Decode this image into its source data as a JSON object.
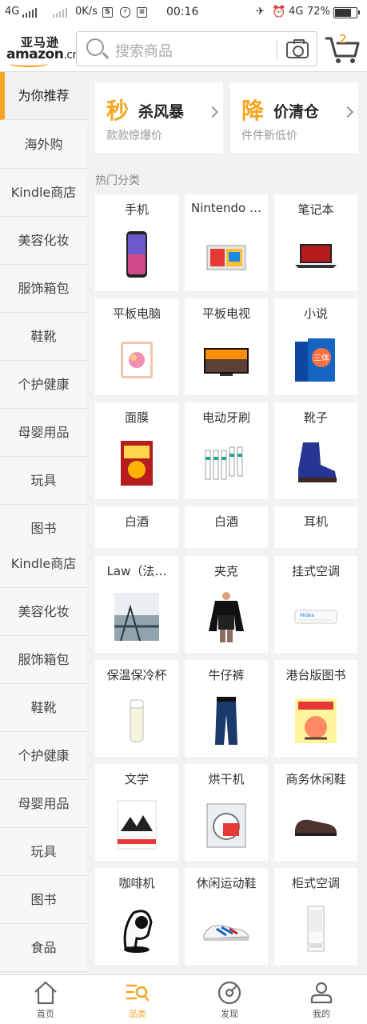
{
  "status_bar": {
    "network": "4G",
    "speed": "0K/s",
    "time": "00:16",
    "network_right": "4G",
    "battery": "72%"
  },
  "header": {
    "logo_cn": "亚马逊",
    "logo_en": "amazon",
    "logo_domain": ".cn",
    "search_placeholder": "搜索商品",
    "cart_count": "2"
  },
  "sidebar": {
    "items": [
      {
        "label": "为你推荐",
        "active": true
      },
      {
        "label": "海外购"
      },
      {
        "label": "Kindle商店"
      },
      {
        "label": "美容化妆"
      },
      {
        "label": "服饰箱包"
      },
      {
        "label": "鞋靴"
      },
      {
        "label": "个护健康"
      },
      {
        "label": "母婴用品"
      },
      {
        "label": "玩具"
      },
      {
        "label": "图书"
      },
      {
        "label": "Kindle商店"
      },
      {
        "label": "美容化妆"
      },
      {
        "label": "服饰箱包"
      },
      {
        "label": "鞋靴"
      },
      {
        "label": "个护健康"
      },
      {
        "label": "母婴用品"
      },
      {
        "label": "玩具"
      },
      {
        "label": "图书"
      },
      {
        "label": "食品"
      }
    ]
  },
  "promos": [
    {
      "icon_char": "秒",
      "title": "杀风暴",
      "subtitle": "款款惊爆价"
    },
    {
      "icon_char": "降",
      "title": "价清仓",
      "subtitle": "件件新低价"
    }
  ],
  "section_title": "热门分类",
  "categories": [
    {
      "label": "手机",
      "icon": "phone"
    },
    {
      "label": "Nintendo …",
      "icon": "game-console"
    },
    {
      "label": "笔记本",
      "icon": "laptop"
    },
    {
      "label": "平板电脑",
      "icon": "tablet"
    },
    {
      "label": "平板电视",
      "icon": "tv"
    },
    {
      "label": "小说",
      "icon": "books"
    },
    {
      "label": "面膜",
      "icon": "face-mask"
    },
    {
      "label": "电动牙刷",
      "icon": "toothbrush-heads"
    },
    {
      "label": "靴子",
      "icon": "boot"
    },
    {
      "label": "白酒",
      "icon": "none"
    },
    {
      "label": "白酒",
      "icon": "none"
    },
    {
      "label": "耳机",
      "icon": "none"
    },
    {
      "label": "Law（法…",
      "icon": "law-book"
    },
    {
      "label": "夹克",
      "icon": "jacket"
    },
    {
      "label": "挂式空调",
      "icon": "air-conditioner"
    },
    {
      "label": "保温保冷杯",
      "icon": "thermos"
    },
    {
      "label": "牛仔裤",
      "icon": "jeans"
    },
    {
      "label": "港台版图书",
      "icon": "hk-book"
    },
    {
      "label": "文学",
      "icon": "literature-book"
    },
    {
      "label": "烘干机",
      "icon": "dryer"
    },
    {
      "label": "商务休闲鞋",
      "icon": "leather-shoe"
    },
    {
      "label": "咖啡机",
      "icon": "coffee-machine"
    },
    {
      "label": "休闲运动鞋",
      "icon": "sneaker"
    },
    {
      "label": "柜式空调",
      "icon": "tower-ac"
    }
  ],
  "tabbar": {
    "items": [
      {
        "label": "首页",
        "icon": "home-icon"
      },
      {
        "label": "品类",
        "icon": "category-icon",
        "active": true
      },
      {
        "label": "发现",
        "icon": "discover-icon"
      },
      {
        "label": "我的",
        "icon": "profile-icon"
      }
    ]
  },
  "colors": {
    "accent": "#f5a623",
    "brand_orange": "#ff9900"
  }
}
